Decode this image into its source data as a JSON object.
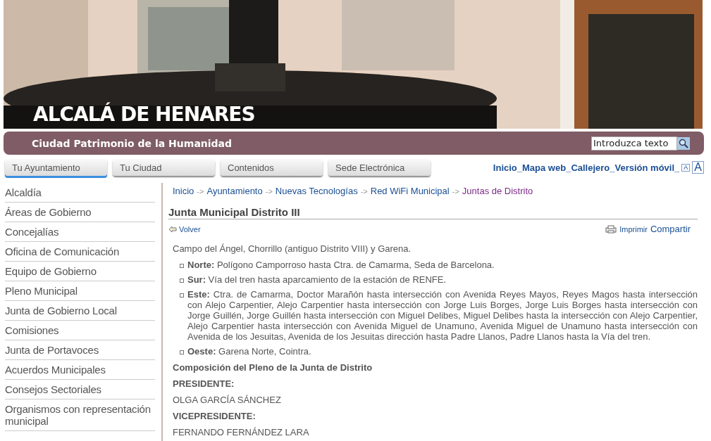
{
  "header": {
    "title": "ALCALÁ DE HENARES",
    "subtitle": "Ciudad Patrimonio de la Humanidad",
    "search": {
      "placeholder": "Introduzca texto"
    }
  },
  "nav_tabs": [
    {
      "label": "Tu Ayuntamiento",
      "selected": true
    },
    {
      "label": "Tu Ciudad",
      "selected": false
    },
    {
      "label": "Contenidos",
      "selected": false
    },
    {
      "label": "Sede Electrónica",
      "selected": false
    }
  ],
  "top_links": {
    "separator": "_",
    "items": [
      "Inicio",
      "Mapa web",
      "Callejero",
      "Versión móvil"
    ],
    "font_buttons": [
      "A",
      "A"
    ]
  },
  "sidebar": {
    "items": [
      "Alcaldía",
      "Áreas de Gobierno",
      "Concejalías",
      "Oficina de Comunicación",
      "Equipo de Gobierno",
      "Pleno Municipal",
      "Junta de Gobierno Local",
      "Comisiones",
      "Junta de Portavoces",
      "Acuerdos Municipales",
      "Consejos Sectoriales",
      "Organismos con representación municipal"
    ]
  },
  "breadcrumb": {
    "separator": "->",
    "items": [
      {
        "label": "Inicio",
        "selected": false
      },
      {
        "label": "Ayuntamiento",
        "selected": false
      },
      {
        "label": "Nuevas Tecnologías",
        "selected": false
      },
      {
        "label": "Red WiFi Municipal",
        "selected": false
      },
      {
        "label": "Juntas de Distrito",
        "selected": true
      }
    ]
  },
  "content": {
    "title": "Junta Municipal Distrito III",
    "back": "Volver",
    "print": "Imprimir",
    "share": "Compartir",
    "intro": "Campo del Ángel, Chorrillo (antiguo Distrito VIII) y Garena.",
    "limits": [
      {
        "label": "Norte:",
        "text": "Polígono Camporroso hasta Ctra. de Camarma, Seda de Barcelona."
      },
      {
        "label": "Sur:",
        "text": "Vía del tren hasta aparcamiento de la estación de RENFE."
      },
      {
        "label": "Este:",
        "text": "Ctra. de Camarma, Doctor Marañón hasta intersección con Avenida Reyes Mayos, Reyes Magos hasta intersección con Alejo Carpentier, Alejo Carpentier hasta intersección con Jorge Luis Borges, Jorge Luis Borges hasta intersección con Jorge Guillén, Jorge Guillén hasta intersección con Miguel Delibes, Miguel Delibes hasta la intersección con Alejo Carpentier, Alejo Carpentier hasta intersección con Avenida Miguel de Unamuno, Avenida Miguel de Unamuno hasta intersección con Avenida de los Jesuitas, Avenida de los Jesuitas dirección hasta Padre Llanos, Padre Llanos hasta la Vía del tren."
      },
      {
        "label": "Oeste:",
        "text": "Garena Norte, Cointra."
      }
    ],
    "blocks": [
      {
        "kind": "heading",
        "text": "Composición del Pleno de la Junta de Distrito"
      },
      {
        "kind": "heading",
        "text": "PRESIDENTE:"
      },
      {
        "kind": "name",
        "text": "OLGA GARCÍA SÁNCHEZ"
      },
      {
        "kind": "heading",
        "text": "VICEPRESIDENTE:"
      },
      {
        "kind": "name",
        "text": "FERNANDO FERNÁNDEZ LARA"
      }
    ]
  }
}
